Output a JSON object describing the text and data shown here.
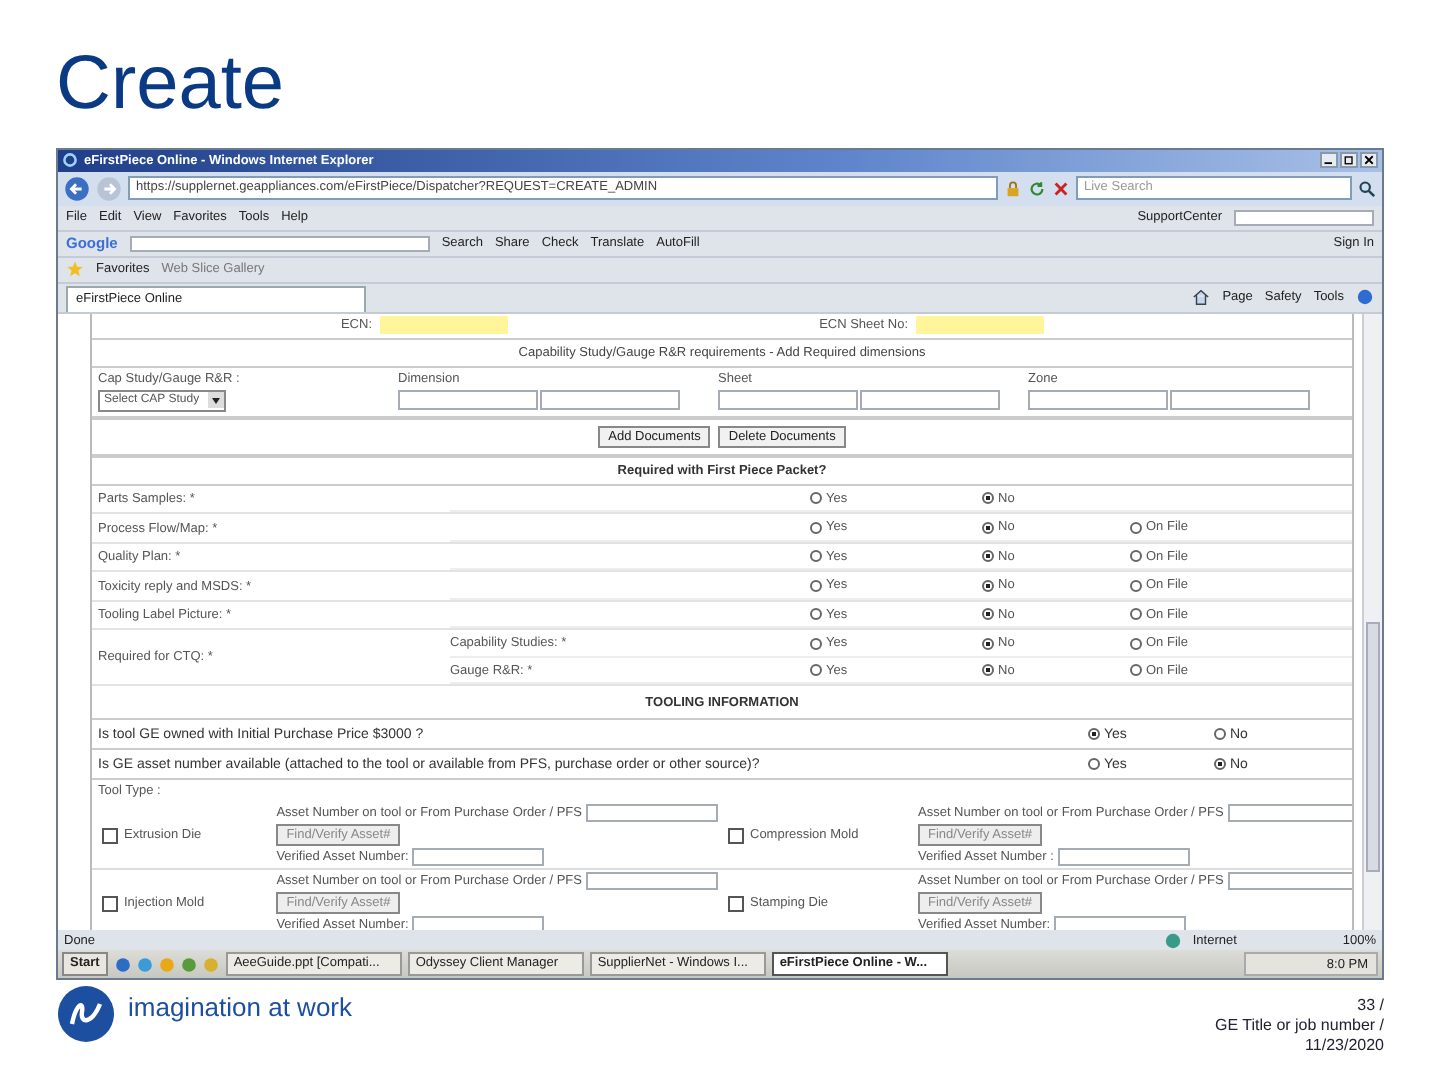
{
  "slide": {
    "title": "Create",
    "tagline": "imagination at work",
    "page": "33 /",
    "footer_title": "GE Title or job number /",
    "date": "11/23/2020"
  },
  "browser": {
    "title": "eFirstPiece Online - Windows Internet Explorer",
    "url": "https://supplernet.geappliances.com/eFirstPiece/Dispatcher?REQUEST=CREATE_ADMIN",
    "search_placeholder": "Live Search",
    "menu": [
      "File",
      "Edit",
      "View",
      "Favorites",
      "Tools",
      "Help"
    ],
    "support": "SupportCenter",
    "google": "Google",
    "google_tools": [
      "Search",
      "Share",
      "Check",
      "Translate",
      "AutoFill"
    ],
    "sign_in": "Sign In",
    "favorites": "Favorites",
    "web_slice": "Web Slice Gallery",
    "tab": "eFirstPiece Online",
    "commands": [
      "Page",
      "Safety",
      "Tools"
    ],
    "status": "Done",
    "zone": "Internet",
    "zoom": "100%"
  },
  "form": {
    "ecn_label": "ECN:",
    "ecn_sheet_label": "ECN Sheet No:",
    "capability": {
      "title": "Capability Study/Gauge R&R requirements - Add Required dimensions",
      "columns": [
        "Cap Study/Gauge R&R :",
        "Dimension",
        "Sheet",
        "Zone"
      ],
      "select": "Select CAP Study"
    },
    "buttons": [
      "Add Documents",
      "Delete Documents"
    ],
    "first_piece": {
      "title": "Required with First Piece Packet?",
      "rows": [
        {
          "label": "Parts Samples: *",
          "options": [
            {
              "label": "Yes",
              "selected": false
            },
            {
              "label": "No",
              "selected": true
            }
          ]
        },
        {
          "label": "Process Flow/Map: *",
          "options": [
            {
              "label": "Yes",
              "selected": false
            },
            {
              "label": "No",
              "selected": true
            },
            {
              "label": "On File",
              "selected": false
            }
          ]
        },
        {
          "label": "Quality Plan: *",
          "options": [
            {
              "label": "Yes",
              "selected": false
            },
            {
              "label": "No",
              "selected": true
            },
            {
              "label": "On File",
              "selected": false
            }
          ]
        },
        {
          "label": "Toxicity reply and MSDS: *",
          "options": [
            {
              "label": "Yes",
              "selected": false
            },
            {
              "label": "No",
              "selected": true
            },
            {
              "label": "On File",
              "selected": false
            }
          ]
        },
        {
          "label": "Tooling Label Picture: *",
          "options": [
            {
              "label": "Yes",
              "selected": false
            },
            {
              "label": "No",
              "selected": true
            },
            {
              "label": "On File",
              "selected": false
            }
          ]
        },
        {
          "label": "Required for CTQ: *",
          "children": [
            {
              "label": "Capability Studies: *",
              "options": [
                {
                  "label": "Yes",
                  "selected": false
                },
                {
                  "label": "No",
                  "selected": true
                },
                {
                  "label": "On File",
                  "selected": false
                }
              ]
            },
            {
              "label": "Gauge R&R: *",
              "options": [
                {
                  "label": "Yes",
                  "selected": false
                },
                {
                  "label": "No",
                  "selected": true
                },
                {
                  "label": "On File",
                  "selected": false
                }
              ]
            }
          ]
        }
      ]
    },
    "tooling": {
      "title": "TOOLING INFORMATION",
      "questions": [
        {
          "label": "Is tool GE owned with Initial Purchase Price $3000 ?",
          "options": [
            {
              "label": "Yes",
              "selected": true
            },
            {
              "label": "No",
              "selected": false
            }
          ]
        },
        {
          "label": "Is GE asset number available (attached to the tool or available from PFS, purchase order or other source)?",
          "options": [
            {
              "label": "Yes",
              "selected": false
            },
            {
              "label": "No",
              "selected": true
            }
          ]
        }
      ],
      "tool_type_label": "Tool Type :",
      "tools": [
        {
          "name": "Extrusion Die",
          "checked": false,
          "asset_label": "Asset Number on tool or From Purchase Order / PFS",
          "button": "Find/Verify Asset#",
          "verified_label": "Verified Asset Number:"
        },
        {
          "name": "Compression Mold",
          "checked": false,
          "asset_label": "Asset Number on tool or From Purchase Order / PFS",
          "button": "Find/Verify Asset#",
          "verified_label": "Verified Asset Number :"
        },
        {
          "name": "Injection Mold",
          "checked": false,
          "asset_label": "Asset Number on tool or From Purchase Order / PFS",
          "button": "Find/Verify Asset#",
          "verified_label": "Verified Asset Number:"
        },
        {
          "name": "Stamping Die",
          "checked": false,
          "asset_label": "Asset Number on tool or From Purchase Order / PFS",
          "button": "Find/Verify Asset#",
          "verified_label": "Verified Asset Number:"
        }
      ]
    }
  },
  "taskbar": {
    "start": "Start",
    "tasks": [
      {
        "label": "AeeGuide.ppt [Compati...",
        "selected": false
      },
      {
        "label": "Odyssey Client Manager",
        "selected": false
      },
      {
        "label": "SupplierNet - Windows I...",
        "selected": false
      },
      {
        "label": "eFirstPiece Online - W...",
        "selected": true
      }
    ],
    "clock": "8:0 PM"
  }
}
